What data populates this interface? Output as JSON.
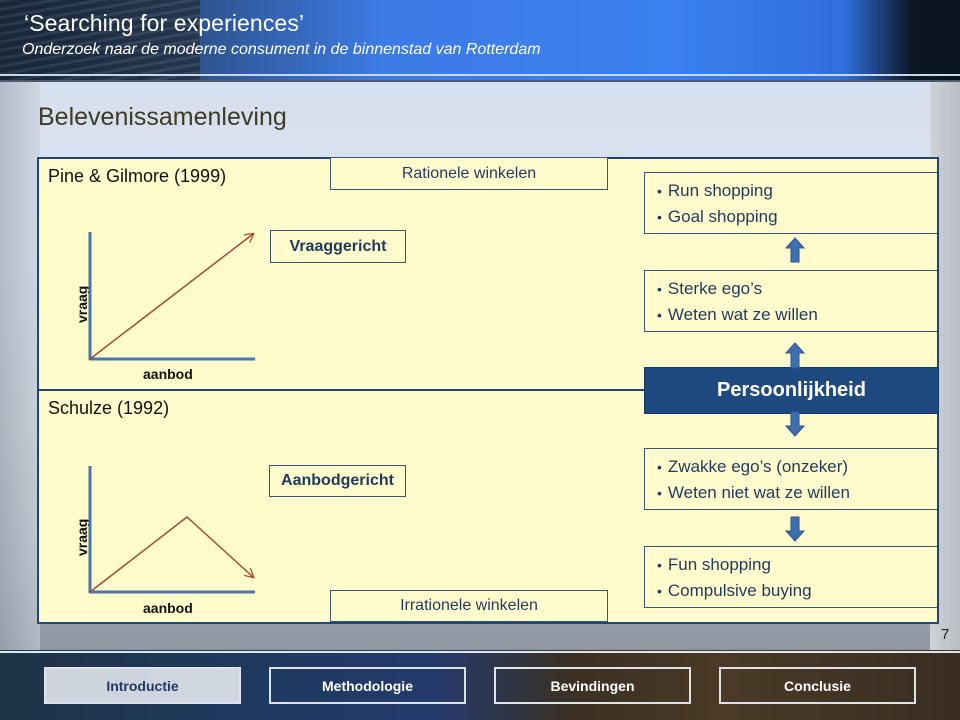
{
  "header": {
    "title": "‘Searching for experiences’",
    "subtitle": "Onderzoek naar de moderne consument in de binnenstad van Rotterdam"
  },
  "section_title": "Belevenissamenleving",
  "top_model": {
    "author": "Pine & Gilmore (1999)",
    "orientation": "Vraaggericht",
    "shopping_type": "Rationele winkelen",
    "axis_x": "aanbod",
    "axis_y": "vraag",
    "curve": "rising"
  },
  "bottom_model": {
    "author": "Schulze (1992)",
    "orientation": "Aanbodgericht",
    "shopping_type": "Irrationele winkelen",
    "axis_x": "aanbod",
    "axis_y": "vraag",
    "curve": "rise-then-fall"
  },
  "right_column": {
    "behaviour_top": [
      "Run shopping",
      "Goal shopping"
    ],
    "traits_top": [
      "Sterke ego’s",
      "Weten wat ze willen"
    ],
    "center": "Persoonlijkheid",
    "traits_bottom": [
      "Zwakke ego’s (onzeker)",
      "Weten niet wat ze willen"
    ],
    "behaviour_bottom": [
      "Fun shopping",
      "Compulsive buying"
    ]
  },
  "page_number": "7",
  "nav": [
    {
      "label": "Introductie",
      "active": true
    },
    {
      "label": "Methodologie",
      "active": false
    },
    {
      "label": "Bevindingen",
      "active": false
    },
    {
      "label": "Conclusie",
      "active": false
    }
  ],
  "colors": {
    "panel_fill": "#fffbcc",
    "panel_border": "#1f4675",
    "accent_blue": "#1f4a80",
    "arrow_blue": "#3d6eae",
    "curve_red": "#a5493a",
    "axis_blue": "#4a76ad"
  }
}
